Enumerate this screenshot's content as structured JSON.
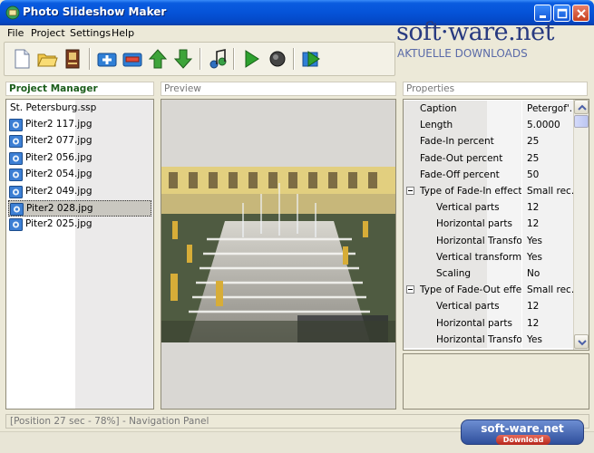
{
  "window": {
    "title": "Photo Slideshow Maker"
  },
  "menu": [
    "File",
    "Project",
    "Settings",
    "Help"
  ],
  "watermark": {
    "title": "soft·ware.net",
    "subtitle": "AKTUELLE DOWNLOADS"
  },
  "toolbar": {
    "buttons": [
      {
        "name": "new-project",
        "icon": "new-document-icon"
      },
      {
        "name": "open-project",
        "icon": "open-folder-icon"
      },
      {
        "name": "save-project",
        "icon": "save-book-icon"
      },
      {
        "name": "add-image",
        "icon": "plus-icon"
      },
      {
        "name": "remove-image",
        "icon": "minus-icon"
      },
      {
        "name": "move-up",
        "icon": "up-arrow-icon"
      },
      {
        "name": "move-down",
        "icon": "down-arrow-icon"
      },
      {
        "name": "music",
        "icon": "music-note-icon"
      },
      {
        "name": "play",
        "icon": "play-icon"
      },
      {
        "name": "stop",
        "icon": "stop-icon"
      },
      {
        "name": "export",
        "icon": "export-icon"
      }
    ]
  },
  "project_manager": {
    "title": "Project Manager",
    "root": "St. Petersburg.ssp",
    "files": [
      "Piter2 117.jpg",
      "Piter2 077.jpg",
      "Piter2 056.jpg",
      "Piter2 054.jpg",
      "Piter2 049.jpg",
      "Piter2 028.jpg",
      "Piter2 025.jpg"
    ],
    "selected_index": 5
  },
  "preview": {
    "title": "Preview"
  },
  "properties": {
    "title": "Properties",
    "rows": [
      {
        "key": "Caption",
        "value": "Petergof'...",
        "level": 0
      },
      {
        "key": "Length",
        "value": "5.0000",
        "level": 0
      },
      {
        "key": "Fade-In percent",
        "value": "25",
        "level": 0
      },
      {
        "key": "Fade-Out percent",
        "value": "25",
        "level": 0
      },
      {
        "key": "Fade-Off percent",
        "value": "50",
        "level": 0
      },
      {
        "key": "Type of Fade-In effect",
        "value": "Small rec...",
        "level": 0,
        "group": true
      },
      {
        "key": "Vertical parts",
        "value": "12",
        "level": 1
      },
      {
        "key": "Horizontal parts",
        "value": "12",
        "level": 1
      },
      {
        "key": "Horizontal Transfor...",
        "value": "Yes",
        "level": 1
      },
      {
        "key": "Vertical transformati...",
        "value": "Yes",
        "level": 1
      },
      {
        "key": "Scaling",
        "value": "No",
        "level": 1
      },
      {
        "key": "Type of Fade-Out effect",
        "value": "Small rec...",
        "level": 0,
        "group": true
      },
      {
        "key": "Vertical parts",
        "value": "12",
        "level": 1
      },
      {
        "key": "Horizontal parts",
        "value": "12",
        "level": 1
      },
      {
        "key": "Horizontal Transfor...",
        "value": "Yes",
        "level": 1
      }
    ]
  },
  "navigation": {
    "text": "[Position 27 sec - 78%] - Navigation Panel"
  },
  "watermark2": {
    "top": "soft-ware.net",
    "bottom": "Download"
  }
}
